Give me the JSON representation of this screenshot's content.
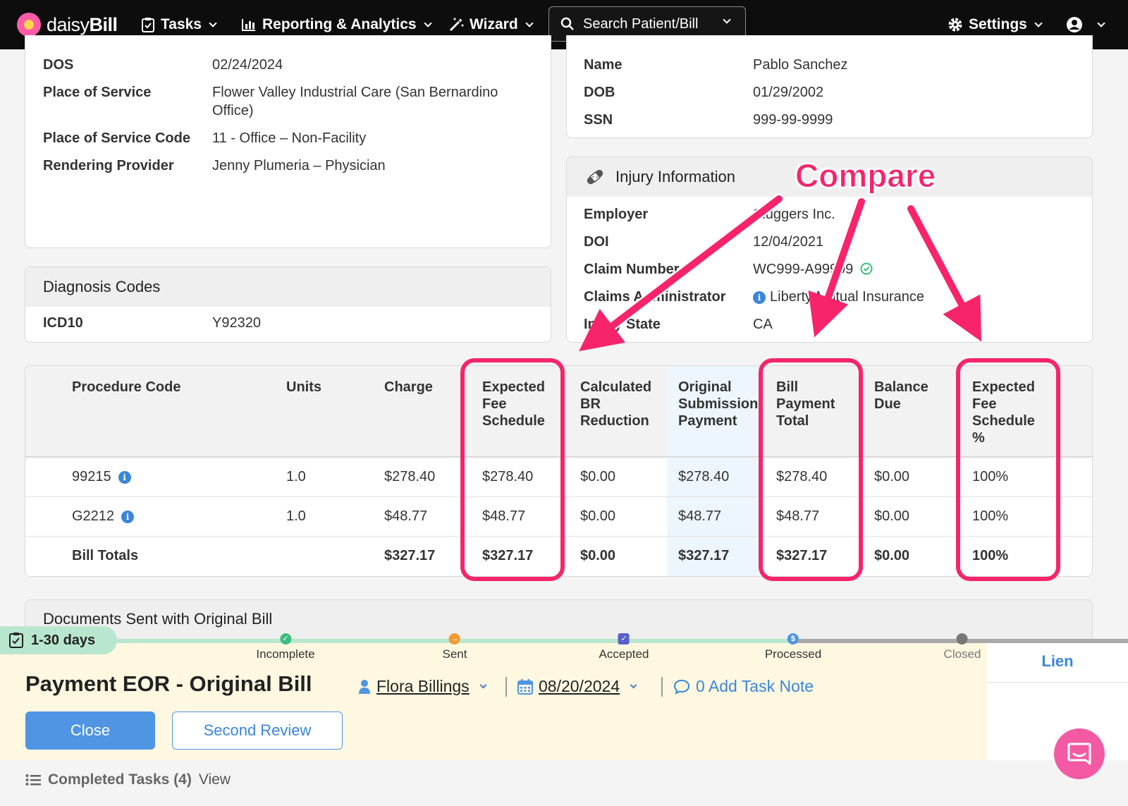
{
  "nav": {
    "logo_text_light": "daisy",
    "logo_text_bold": "Bill",
    "tasks": "Tasks",
    "reporting": "Reporting & Analytics",
    "wizard": "Wizard",
    "search_placeholder": "Search Patient/Bill",
    "settings": "Settings"
  },
  "bill_info": {
    "rows": [
      {
        "k": "DOS",
        "v": "02/24/2024"
      },
      {
        "k": "Place of Service",
        "v": "Flower Valley Industrial Care (San Bernardino",
        "v2": "Office)"
      },
      {
        "k": "Place of Service Code",
        "v": "11 - Office – Non-Facility"
      },
      {
        "k": "Rendering Provider",
        "v": "Jenny Plumeria – Physician"
      }
    ]
  },
  "patient": {
    "rows": [
      {
        "k": "Name",
        "v": "Pablo Sanchez"
      },
      {
        "k": "DOB",
        "v": "01/29/2002"
      },
      {
        "k": "SSN",
        "v": "999-99-9999"
      }
    ]
  },
  "injury": {
    "title": "Injury Information",
    "rows": [
      {
        "k": "Employer",
        "v": "Sluggers Inc."
      },
      {
        "k": "DOI",
        "v": "12/04/2021"
      },
      {
        "k": "Claim Number",
        "v": "WC999-A99999"
      },
      {
        "k": "Claims Administrator",
        "v": "Liberty Mutual Insurance"
      },
      {
        "k": "Injury State",
        "v": "CA"
      }
    ]
  },
  "diagnosis": {
    "title": "Diagnosis Codes",
    "k": "ICD10",
    "v": "Y92320"
  },
  "table": {
    "headers": [
      "Procedure Code",
      "Units",
      "Charge",
      "Expected\nFee\nSchedule",
      "Calculated\nBR\nReduction",
      "Original\nSubmission\nPayment",
      "Bill\nPayment\nTotal",
      "Balance\nDue",
      "Expected\nFee\nSchedule\n%"
    ],
    "rows": [
      [
        "99215",
        "1.0",
        "$278.40",
        "$278.40",
        "$0.00",
        "$278.40",
        "$278.40",
        "$0.00",
        "100%"
      ],
      [
        "G2212",
        "1.0",
        "$48.77",
        "$48.77",
        "$0.00",
        "$48.77",
        "$48.77",
        "$0.00",
        "100%"
      ]
    ],
    "totals": [
      "Bill Totals",
      "",
      "$327.17",
      "$327.17",
      "$0.00",
      "$327.17",
      "$327.17",
      "$0.00",
      "100%"
    ]
  },
  "annotation": {
    "label": "Compare",
    "color": "#f7246c"
  },
  "documents": {
    "title": "Documents Sent with Original Bill"
  },
  "task": {
    "days_badge": "1-30 days",
    "steps": [
      "Incomplete",
      "Sent",
      "Accepted",
      "Processed",
      "Closed"
    ],
    "title": "Payment EOR - Original Bill",
    "assignee": "Flora Billings",
    "date": "08/20/2024",
    "note": "0 Add Task Note",
    "close_label": "Close",
    "second_review_label": "Second Review",
    "lien_tab": "Lien"
  },
  "completed": {
    "label": "Completed Tasks (4)",
    "view": "View"
  },
  "colors": {
    "accent": "#4f95e3",
    "pink": "#f7246c",
    "task_bg": "#fff8e1"
  }
}
